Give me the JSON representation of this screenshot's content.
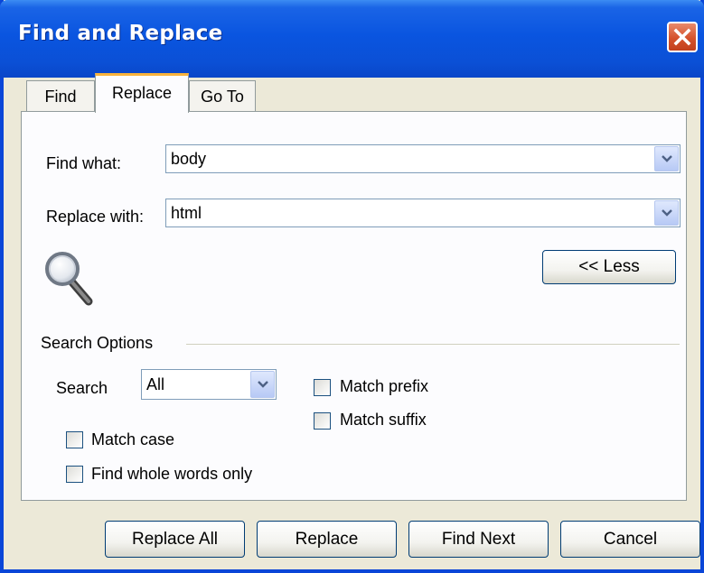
{
  "window": {
    "title": "Find and Replace"
  },
  "tabs": [
    {
      "label": "Find",
      "active": false
    },
    {
      "label": "Replace",
      "active": true
    },
    {
      "label": "Go To",
      "active": false
    }
  ],
  "find_what": {
    "label": "Find what:",
    "value": "body"
  },
  "replace_with": {
    "label": "Replace with:",
    "value": "html"
  },
  "less_button": {
    "label": "<< Less"
  },
  "search_options": {
    "heading": "Search Options",
    "search_label": "Search",
    "search_value": "All",
    "match_prefix": {
      "label": "Match prefix",
      "checked": false
    },
    "match_suffix": {
      "label": "Match suffix",
      "checked": false
    },
    "match_case": {
      "label": "Match case",
      "checked": false
    },
    "whole_words": {
      "label": "Find whole words only",
      "checked": false
    }
  },
  "buttons": {
    "replace_all": "Replace All",
    "replace": "Replace",
    "find_next": "Find Next",
    "cancel": "Cancel"
  },
  "icons": [
    "close-icon",
    "dropdown-arrow-icon",
    "magnifier-icon"
  ]
}
